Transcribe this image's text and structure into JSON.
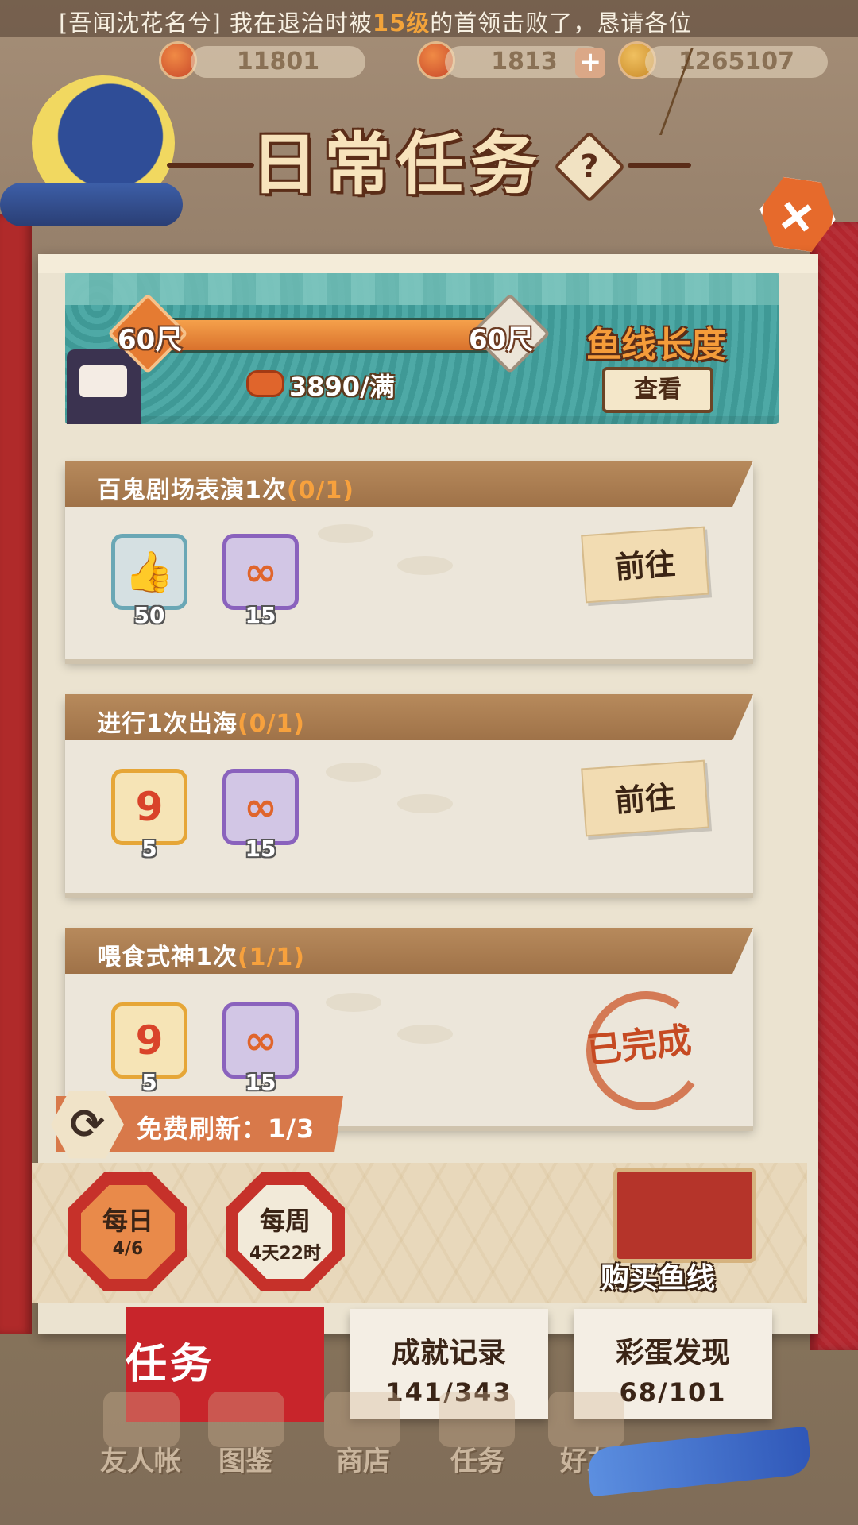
{
  "ticker": {
    "prefix": "[吾闻沈花名兮] 我在退治时被",
    "highlight": "15级",
    "suffix": "的首领击败了，恳请各位"
  },
  "resources": [
    {
      "value": "11801"
    },
    {
      "value": "1813"
    },
    {
      "value": "1265107"
    }
  ],
  "header": {
    "title": "日常任务",
    "help_label": "?",
    "close_label": "+"
  },
  "fishing_line": {
    "left_length": "60尺",
    "right_length": "60尺",
    "progress": 1.0,
    "count": "3890/满",
    "title": "鱼线长度",
    "view_button": "查看"
  },
  "tasks": [
    {
      "name": "百鬼剧场表演1次",
      "progress": "(0/1)",
      "rewards": [
        {
          "icon": "like-card-icon",
          "qty": "50"
        },
        {
          "icon": "fishing-line-icon",
          "qty": "15"
        }
      ],
      "action": "前往",
      "done": false
    },
    {
      "name": "进行1次出海",
      "progress": "(0/1)",
      "rewards": [
        {
          "icon": "hook-coin-icon",
          "qty": "5"
        },
        {
          "icon": "fishing-line-icon",
          "qty": "15"
        }
      ],
      "action": "前往",
      "done": false
    },
    {
      "name": "喂食式神1次",
      "progress": "(1/1)",
      "rewards": [
        {
          "icon": "hook-coin-icon",
          "qty": "5"
        },
        {
          "icon": "fishing-line-icon",
          "qty": "15"
        }
      ],
      "action": "已完成",
      "done": true
    }
  ],
  "refresh": {
    "label": "免费刷新：1/3"
  },
  "period_tabs": {
    "daily": {
      "label": "每日",
      "sub": "4/6"
    },
    "weekly": {
      "label": "每周",
      "sub": "4天22时"
    }
  },
  "buy_line": {
    "label": "购买鱼线"
  },
  "section_tabs": [
    {
      "label": "任务",
      "active": true
    },
    {
      "label": "成就记录",
      "count": "141/343"
    },
    {
      "label": "彩蛋发现",
      "count": "68/101"
    }
  ],
  "bottom_nav": [
    "友人帐",
    "图鉴",
    "商店",
    "任务",
    "好友"
  ],
  "colors": {
    "accent_red": "#c8252b",
    "panel": "#ebe3d0",
    "teal": "#4ea9a6",
    "orange": "#e57b32"
  }
}
